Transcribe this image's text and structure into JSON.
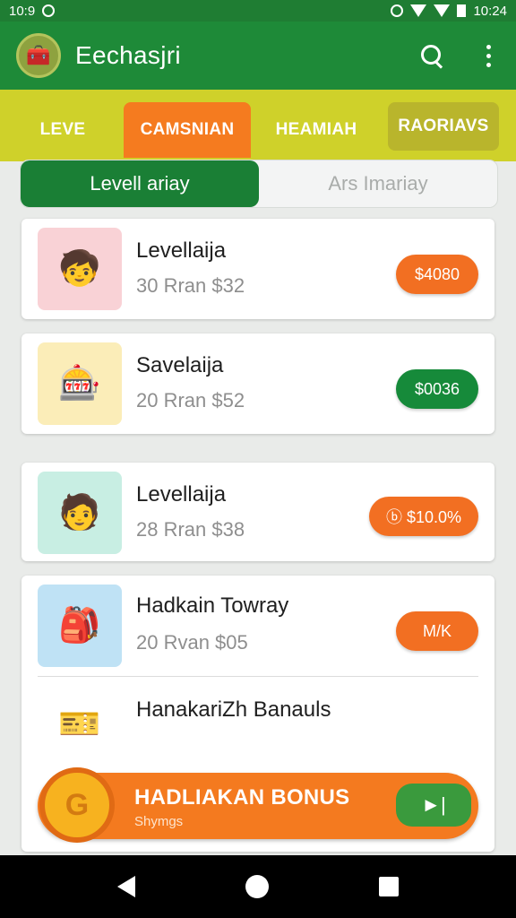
{
  "status_bar": {
    "time_left": "10:9",
    "time_right": "10:24"
  },
  "app_bar": {
    "title": "Eechasjri",
    "logo_icon": "🧰"
  },
  "tabs": [
    {
      "label": "LEVE"
    },
    {
      "label": "CAMSNIAN"
    },
    {
      "label": "HEAMIAH"
    },
    {
      "label": "RAORIAVS"
    }
  ],
  "segments": [
    {
      "label": "Levell ariay"
    },
    {
      "label": "Ars Imariay"
    }
  ],
  "items": [
    {
      "title": "Levellaija",
      "subtitle": "30 Rran  $32",
      "button": "$4080",
      "thumb_icon": "🧒"
    },
    {
      "title": "Savelaija",
      "subtitle": "20 Rran  $52",
      "button": "$0036",
      "thumb_icon": "🎰"
    },
    {
      "title": "Levellaija",
      "subtitle": "28 Rran  $38",
      "button": "ⓑ $10.0%",
      "thumb_icon": "🧑"
    },
    {
      "title": "Hadkain Towray",
      "subtitle": "20 Rvan  $05",
      "button": "M/K",
      "thumb_icon": "🎒"
    },
    {
      "title": "HanakariZh Banauls",
      "thumb_icon": "🎫"
    }
  ],
  "bonus": {
    "title": "HADLIAKAN BONUS",
    "subtitle": "Shymgs",
    "coin_label": "G",
    "button": "►|"
  },
  "colors": {
    "primary": "#1e8a38",
    "accent": "#f47a1f",
    "tab_bar": "#cfd12a"
  }
}
